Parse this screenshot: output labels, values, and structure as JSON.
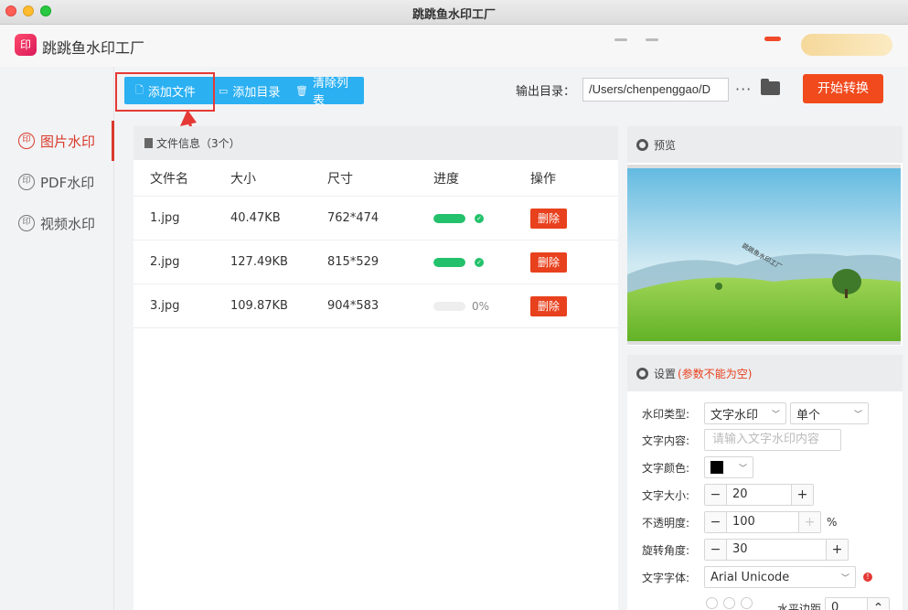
{
  "window": {
    "title": "跳跳鱼水印工厂"
  },
  "app": {
    "name": "跳跳鱼水印工厂",
    "logo_text": "印"
  },
  "sidebar": {
    "items": [
      {
        "label": "图片水印",
        "icon_text": "印",
        "active": true
      },
      {
        "label": "PDF水印",
        "icon_text": "印",
        "active": false
      },
      {
        "label": "视频水印",
        "icon_text": "印",
        "active": false
      }
    ]
  },
  "toolbar": {
    "add_file": "添加文件",
    "add_dir": "添加目录",
    "clear_list": "清除列表",
    "output_label": "输出目录：",
    "output_path": "/Users/chenpenggao/D",
    "more": "···",
    "start": "开始转换"
  },
  "file_panel": {
    "title": "文件信息（3个）",
    "columns": [
      "文件名",
      "大小",
      "尺寸",
      "进度",
      "操作"
    ],
    "rows": [
      {
        "name": "1.jpg",
        "size": "40.47KB",
        "dims": "762*474",
        "progress": 1.0,
        "done": true,
        "pct_text": "",
        "action": "删除"
      },
      {
        "name": "2.jpg",
        "size": "127.49KB",
        "dims": "815*529",
        "progress": 1.0,
        "done": true,
        "pct_text": "",
        "action": "删除"
      },
      {
        "name": "3.jpg",
        "size": "109.87KB",
        "dims": "904*583",
        "progress": 0.0,
        "done": false,
        "pct_text": "0%",
        "action": "删除"
      }
    ]
  },
  "preview": {
    "title": "预览",
    "watermark_text": "跳跳鱼水印工厂"
  },
  "settings": {
    "title": "设置",
    "note": "(参数不能为空)",
    "type_label": "水印类型:",
    "type_value": "文字水印",
    "mode_value": "单个",
    "content_label": "文字内容:",
    "content_placeholder": "请输入文字水印内容",
    "color_label": "文字颜色:",
    "color_value": "#000000",
    "size_label": "文字大小:",
    "size_value": "20",
    "opacity_label": "不透明度:",
    "opacity_value": "100",
    "opacity_unit": "%",
    "rotation_label": "旋转角度:",
    "rotation_value": "30",
    "font_label": "文字字体:",
    "font_value": "Arial Unicode",
    "hmargin_label": "水平边距",
    "hmargin_value": "0"
  },
  "colors": {
    "accent_blue": "#2bb0f2",
    "accent_red": "#f04a1d",
    "progress_green": "#23c16b",
    "annotation_red": "#e53935"
  }
}
